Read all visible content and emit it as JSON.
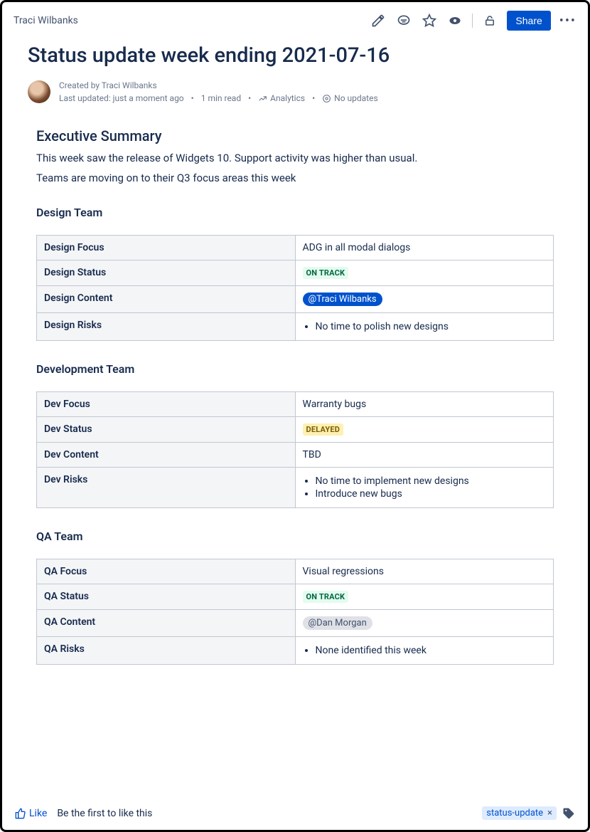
{
  "breadcrumb": "Traci Wilbanks",
  "toolbar": {
    "share_label": "Share"
  },
  "page_title": "Status update week ending 2021-07-16",
  "byline": {
    "created_by_prefix": "Created by ",
    "author": "Traci Wilbanks",
    "last_updated": "Last updated: just a moment ago",
    "read_time": "1 min read",
    "analytics": "Analytics",
    "no_updates": "No updates"
  },
  "exec_summary": {
    "heading": "Executive Summary",
    "p1": "This week saw the release of Widgets 10. Support activity was higher than usual.",
    "p2": "Teams are moving on to their Q3 focus areas this week"
  },
  "teams": {
    "design": {
      "heading": "Design Team",
      "rows": {
        "focus_label": "Design Focus",
        "focus_value": "ADG in all modal dialogs",
        "status_label": "Design Status",
        "status_value": "ON TRACK",
        "content_label": "Design Content",
        "content_mention": "@Traci Wilbanks",
        "risks_label": "Design Risks",
        "risks": [
          "No time to polish new designs"
        ]
      }
    },
    "dev": {
      "heading": "Development Team",
      "rows": {
        "focus_label": "Dev Focus",
        "focus_value": "Warranty bugs",
        "status_label": "Dev Status",
        "status_value": "DELAYED",
        "content_label": "Dev Content",
        "content_value": "TBD",
        "risks_label": "Dev Risks",
        "risks": [
          "No time to implement new designs",
          "Introduce new bugs"
        ]
      }
    },
    "qa": {
      "heading": "QA Team",
      "rows": {
        "focus_label": "QA Focus",
        "focus_value": "Visual regressions",
        "status_label": "QA Status",
        "status_value": "ON TRACK",
        "content_label": "QA Content",
        "content_mention": "@Dan Morgan",
        "risks_label": "QA Risks",
        "risks": [
          "None identified this week"
        ]
      }
    }
  },
  "footer": {
    "like_label": "Like",
    "like_prompt": "Be the first to like this",
    "tag": "status-update"
  }
}
